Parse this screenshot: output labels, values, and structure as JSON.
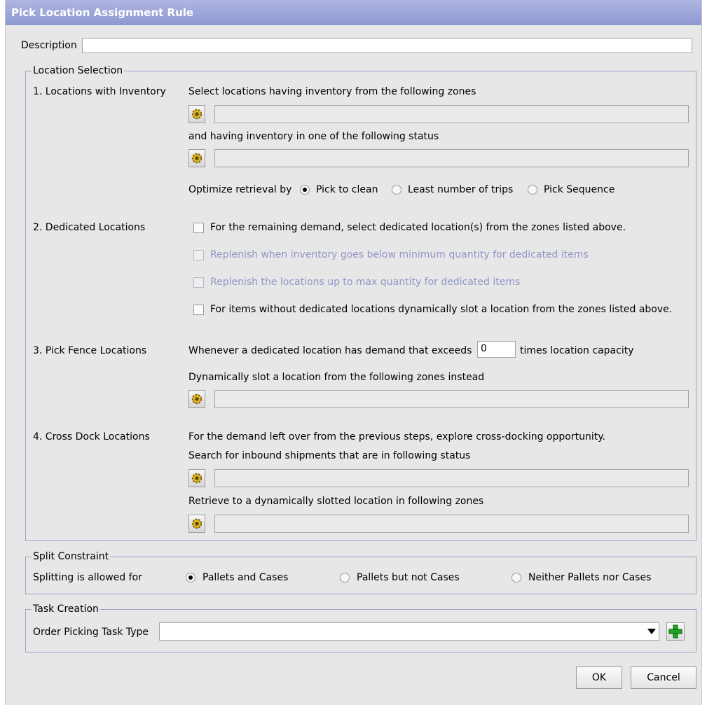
{
  "window": {
    "title": "Pick Location Assignment Rule"
  },
  "description": {
    "label": "Description",
    "value": ""
  },
  "location_selection": {
    "legend": "Location Selection",
    "inventory": {
      "label": "1. Locations with Inventory",
      "zones_text": "Select locations having inventory from the following zones",
      "status_text": "and having inventory in one of the following status",
      "optimize_label": "Optimize retrieval by",
      "options": [
        "Pick to clean",
        "Least number of trips",
        "Pick Sequence"
      ],
      "selected": "Pick to clean"
    },
    "dedicated": {
      "label": "2. Dedicated Locations",
      "checks": [
        {
          "text": "For the remaining demand, select dedicated location(s) from the zones listed above.",
          "checked": false,
          "enabled": true
        },
        {
          "text": "Replenish when inventory goes below minimum quantity for dedicated items",
          "checked": false,
          "enabled": false
        },
        {
          "text": "Replenish the locations up to max quantity for dedicated items",
          "checked": false,
          "enabled": false
        },
        {
          "text": "For items without dedicated locations dynamically slot a location from the zones listed above.",
          "checked": false,
          "enabled": true
        }
      ]
    },
    "pick_fence": {
      "label": "3. Pick Fence Locations",
      "text_before": "Whenever a dedicated location has demand that exceeds",
      "times_value": "0",
      "text_after": "times location capacity",
      "slot_text": "Dynamically slot a location from the following zones instead"
    },
    "cross_dock": {
      "label": "4. Cross Dock Locations",
      "text1": "For the demand left over from the previous steps, explore cross-docking opportunity.",
      "text2": "Search for inbound shipments that are in following status",
      "text3": "Retrieve to a dynamically slotted location in following zones"
    }
  },
  "split_constraint": {
    "legend": "Split Constraint",
    "label": "Splitting is allowed for",
    "options": [
      "Pallets and Cases",
      "Pallets but not Cases",
      "Neither Pallets nor Cases"
    ],
    "selected": "Pallets and Cases"
  },
  "task_creation": {
    "legend": "Task Creation",
    "label": "Order Picking Task Type",
    "value": ""
  },
  "buttons": {
    "ok": "OK",
    "cancel": "Cancel"
  },
  "icons": {
    "lookup": "gear-icon",
    "add": "plus-icon",
    "dropdown": "chevron-down-icon"
  },
  "colors": {
    "title_bar": "#9aa2d8",
    "disabled_text": "#9096c8",
    "add_icon": "#1fa51f"
  }
}
